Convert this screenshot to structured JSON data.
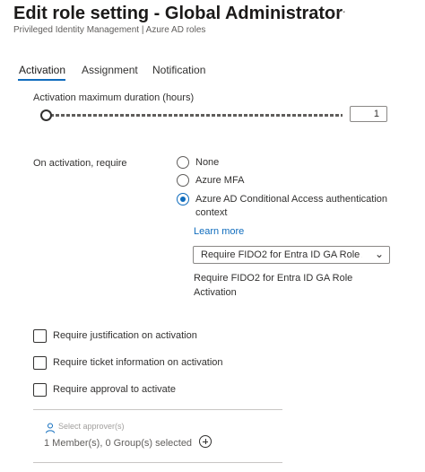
{
  "header": {
    "title": "Edit role setting - Global Administrator",
    "more": "···",
    "subtitle": "Privileged Identity Management | Azure AD roles"
  },
  "tabs": [
    {
      "label": "Activation",
      "active": true
    },
    {
      "label": "Assignment",
      "active": false
    },
    {
      "label": "Notification",
      "active": false
    }
  ],
  "activation": {
    "duration_label": "Activation maximum duration (hours)",
    "duration_value": "1",
    "require_label": "On activation, require",
    "options": [
      {
        "label": "None",
        "selected": false
      },
      {
        "label": "Azure MFA",
        "selected": false
      },
      {
        "label_line1": "Azure AD Conditional Access authentication",
        "label_line2": "context",
        "selected": true
      }
    ],
    "learn_more": "Learn more",
    "context_dropdown": "Require FIDO2 for Entra ID GA Role Act...",
    "context_desc": "Require FIDO2 for Entra ID GA Role Activation"
  },
  "checkboxes": [
    {
      "label": "Require justification on activation",
      "checked": false
    },
    {
      "label": "Require ticket information on activation",
      "checked": false
    },
    {
      "label": "Require approval to activate",
      "checked": false
    }
  ],
  "approvers": {
    "placeholder": "Select approver(s)",
    "selected_text": "1 Member(s), 0 Group(s) selected"
  },
  "icons": {
    "person": "person-icon",
    "add": "add-circle-icon",
    "chevron": "chevron-down-icon"
  },
  "colors": {
    "accent": "#0f6cbd"
  }
}
